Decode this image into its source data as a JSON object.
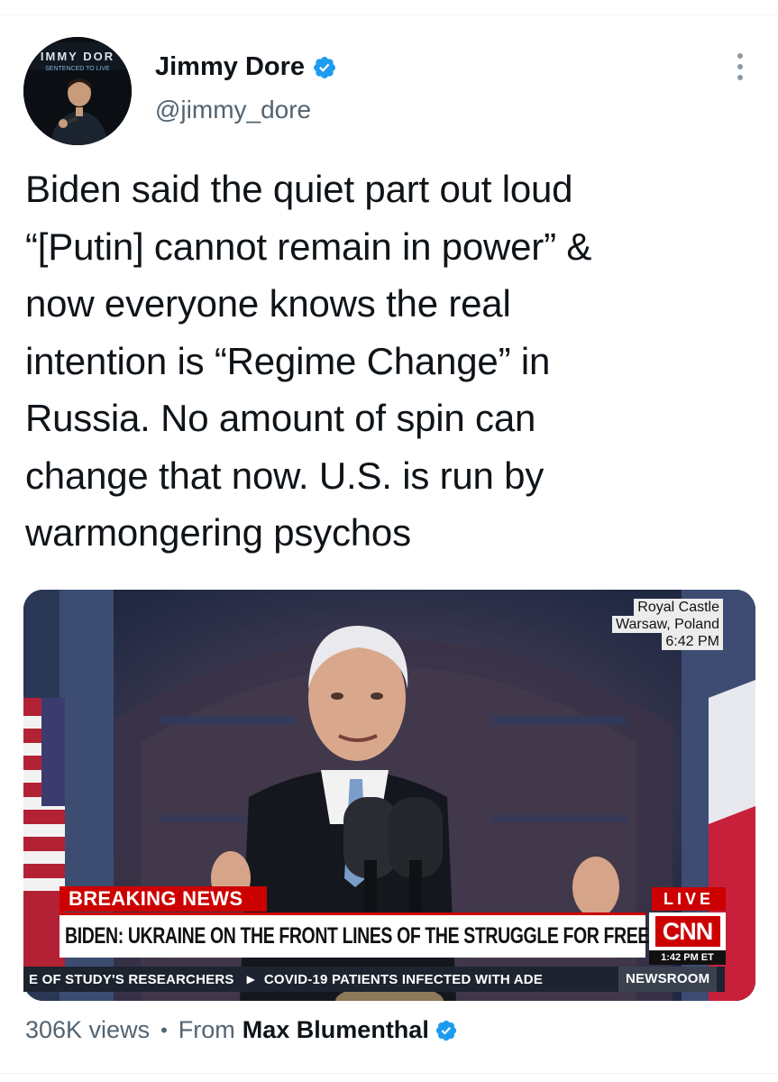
{
  "author": {
    "display_name": "Jimmy Dore",
    "handle": "@jimmy_dore",
    "avatar_text_top": "IMMY DOR",
    "avatar_text_sub": "SENTENCED TO LIVE",
    "verified": true
  },
  "tweet": {
    "lines": [
      "Biden said the quiet part out loud",
      "“[Putin] cannot remain in power” &",
      "now everyone knows the real",
      "intention is “Regime Change” in",
      "Russia. No amount of spin can",
      "change that now. U.S. is run by",
      "warmongering psychos"
    ]
  },
  "media": {
    "location": [
      "Royal Castle",
      "Warsaw, Poland",
      "6:42 PM"
    ],
    "breaking_label": "BREAKING NEWS",
    "headline": "BIDEN: UKRAINE ON THE FRONT LINES OF THE STRUGGLE FOR FREEDOM",
    "live_label": "LIVE",
    "network_logo": "CNN",
    "time_et": "1:42 PM ET",
    "ticker_left": "E OF STUDY'S RESEARCHERS",
    "ticker_right": "COVID-19 PATIENTS INFECTED WITH ADE",
    "program": "NEWSROOM"
  },
  "footer": {
    "views": "306K views",
    "separator": "•",
    "from_label": "From",
    "from_name": "Max Blumenthal",
    "from_verified": true
  },
  "colors": {
    "verified_blue": "#1d9bf0",
    "cnn_red": "#cc0000",
    "secondary_text": "#536471"
  },
  "icons": {
    "verified": "verified-badge-icon",
    "more": "more-dots-icon",
    "ticker_arrow": "play-triangle-icon"
  }
}
